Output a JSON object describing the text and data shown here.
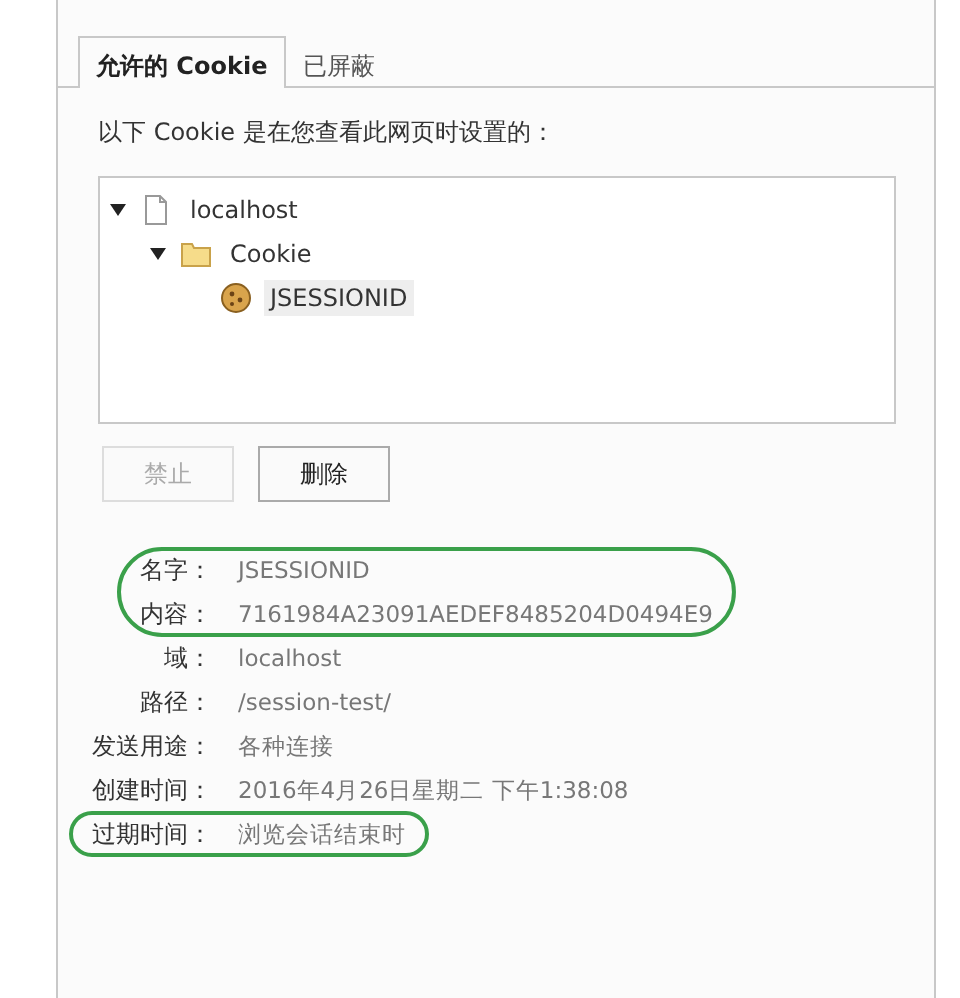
{
  "tabs": [
    {
      "label": "允许的 Cookie",
      "selected": true
    },
    {
      "label": "已屏蔽",
      "selected": false
    }
  ],
  "intro": "以下 Cookie 是在您查看此网页时设置的：",
  "tree": [
    {
      "label": "localhost",
      "kind": "site",
      "expanded": true,
      "selected": false,
      "children": [
        {
          "label": "Cookie",
          "kind": "folder",
          "expanded": true,
          "selected": false,
          "children": [
            {
              "label": "JSESSIONID",
              "kind": "cookie",
              "selected": true
            }
          ]
        }
      ]
    }
  ],
  "buttons": [
    {
      "label": "禁止",
      "disabled": true
    },
    {
      "label": "删除",
      "disabled": false
    }
  ],
  "details": [
    {
      "label": "名字：",
      "value": "JSESSIONID",
      "circled": true
    },
    {
      "label": "内容：",
      "value": "7161984A23091AEDEF8485204D0494E9",
      "circled": true
    },
    {
      "label": "域：",
      "value": "localhost",
      "circled": false
    },
    {
      "label": "路径：",
      "value": "/session-test/",
      "circled": false
    },
    {
      "label": "发送用途：",
      "value": "各种连接",
      "circled": false
    },
    {
      "label": "创建时间：",
      "value": "2016年4月26日星期二 下午1:38:08",
      "circled": false
    },
    {
      "label": "过期时间：",
      "value": "浏览会话结束时",
      "circled": true
    }
  ]
}
